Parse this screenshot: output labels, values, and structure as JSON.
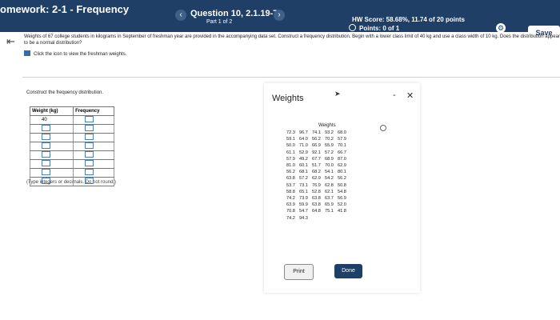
{
  "header": {
    "app_title": "omework: 2-1 - Frequency",
    "prev_icon": "chevron-left-icon",
    "next_icon": "chevron-right-icon",
    "question_title": "Question 10, 2.1.19-T",
    "question_part": "Part 1 of 2",
    "hw_score": "HW Score: 58.68%, 11.74 of 20 points",
    "points": "Points: 0 of 1",
    "save_label": "Save",
    "colors": {
      "bar": "#1f3f66"
    }
  },
  "problem": {
    "text": "Weights of 67 college students in kilograms in September of freshman year are provided in the accompanying data set. Construct a frequency distribution. Begin with a lower class limit of 40 kg and use a class width of 10 kg. Does the distribution appear to be a normal distribution?",
    "link_text": "Click the icon to view the freshman weights."
  },
  "frequency": {
    "instruction": "Construct the frequency distribution.",
    "col_weight": "Weight (kg)",
    "col_frequency": "Frequency",
    "first_lower_limit": "40",
    "hint": "(Type integers or decimals. Do not round.)"
  },
  "modal": {
    "title": "Weights",
    "data_heading": "Weights",
    "print_label": "Print",
    "done_label": "Done",
    "minimize_glyph": "-",
    "close_glyph": "✕",
    "rows": [
      [
        "72.3",
        "96.7",
        "74.1",
        "93.2",
        "68.0"
      ],
      [
        "59.1",
        "64.0",
        "56.2",
        "70.2",
        "57.9"
      ],
      [
        "50.0",
        "71.0",
        "66.9",
        "55.9",
        "70.1"
      ],
      [
        "61.1",
        "52.9",
        "92.1",
        "57.2",
        "66.7"
      ],
      [
        "57.9",
        "49.2",
        "67.7",
        "68.9",
        "87.0"
      ],
      [
        "81.0",
        "60.1",
        "51.7",
        "70.0",
        "62.9"
      ],
      [
        "56.2",
        "68.1",
        "68.2",
        "54.1",
        "80.1"
      ],
      [
        "63.8",
        "57.2",
        "62.9",
        "54.2",
        "56.2"
      ],
      [
        "53.7",
        "73.1",
        "76.9",
        "62.8",
        "50.8"
      ],
      [
        "58.8",
        "65.1",
        "52.8",
        "62.1",
        "54.8"
      ],
      [
        "74.2",
        "73.9",
        "63.8",
        "63.7",
        "56.9"
      ],
      [
        "63.9",
        "59.9",
        "63.8",
        "65.9",
        "52.0"
      ],
      [
        "70.8",
        "54.7",
        "64.8",
        "75.1",
        "41.8"
      ],
      [
        "74.2",
        "94.3",
        "",
        "",
        ""
      ]
    ]
  }
}
